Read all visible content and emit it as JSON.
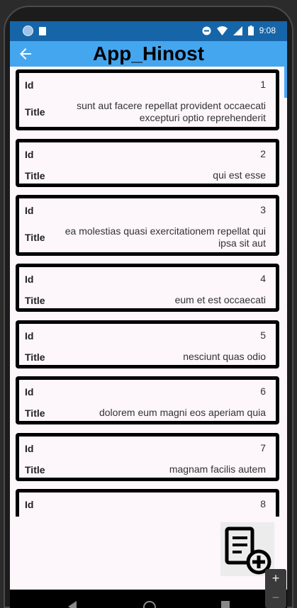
{
  "status_bar": {
    "time": "9:08",
    "icons": [
      "record-icon",
      "sd-card-icon",
      "dnd-icon",
      "wifi-icon",
      "signal-icon",
      "battery-icon"
    ]
  },
  "app_bar": {
    "title": "App_Hinost",
    "back_icon": "arrow-left-icon"
  },
  "list": {
    "id_label": "Id",
    "title_label": "Title",
    "items": [
      {
        "id": "1",
        "title": "sunt aut facere repellat provident occaecati excepturi optio reprehenderit"
      },
      {
        "id": "2",
        "title": "qui est esse"
      },
      {
        "id": "3",
        "title": "ea molestias quasi exercitationem repellat qui ipsa sit aut"
      },
      {
        "id": "4",
        "title": "eum et est occaecati"
      },
      {
        "id": "5",
        "title": "nesciunt quas odio"
      },
      {
        "id": "6",
        "title": "dolorem eum magni eos aperiam quia"
      },
      {
        "id": "7",
        "title": "magnam facilis autem"
      },
      {
        "id": "8",
        "title": ""
      }
    ]
  },
  "fab": {
    "icon": "add-document-icon"
  },
  "zoom": {
    "plus": "+",
    "minus": "−"
  },
  "colors": {
    "status_bar": "#1565a8",
    "app_bar": "#45a6f0",
    "background": "#fdf6fb",
    "card_border": "#000000"
  }
}
